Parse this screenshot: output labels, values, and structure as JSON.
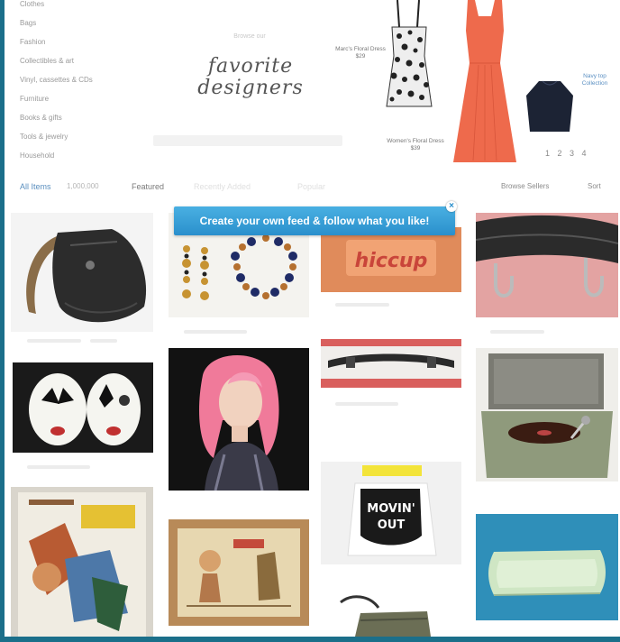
{
  "categories": [
    "Clothes",
    "Bags",
    "Fashion",
    "Collectibles & art",
    "Vinyl, cassettes & CDs",
    "Furniture",
    "Books & gifts",
    "Tools & jewelry",
    "Household"
  ],
  "banner": {
    "small_text": "Browse our",
    "script_line1": "favorite",
    "script_line2": "designers",
    "annotations": {
      "left": "Marc's Floral Dress $29",
      "bottom": "Women's Floral Dress $39",
      "right": "Navy top Collection"
    },
    "pager": "1 2 3 4"
  },
  "toolbar": {
    "all_items": "All Items",
    "count": "1,000,000",
    "featured": "Featured",
    "tab_ghost_1": "Recently Added",
    "tab_ghost_2": "Popular",
    "right_1": "Browse Sellers",
    "right_2": "Sort"
  },
  "feed_banner": {
    "label": "Create your own feed & follow what you like!",
    "close_glyph": "×"
  },
  "colors": {
    "frame": "#1b6f8a",
    "link": "#5b8fbf",
    "banner_top": "#49b0e2",
    "banner_bottom": "#2a8fcc"
  }
}
